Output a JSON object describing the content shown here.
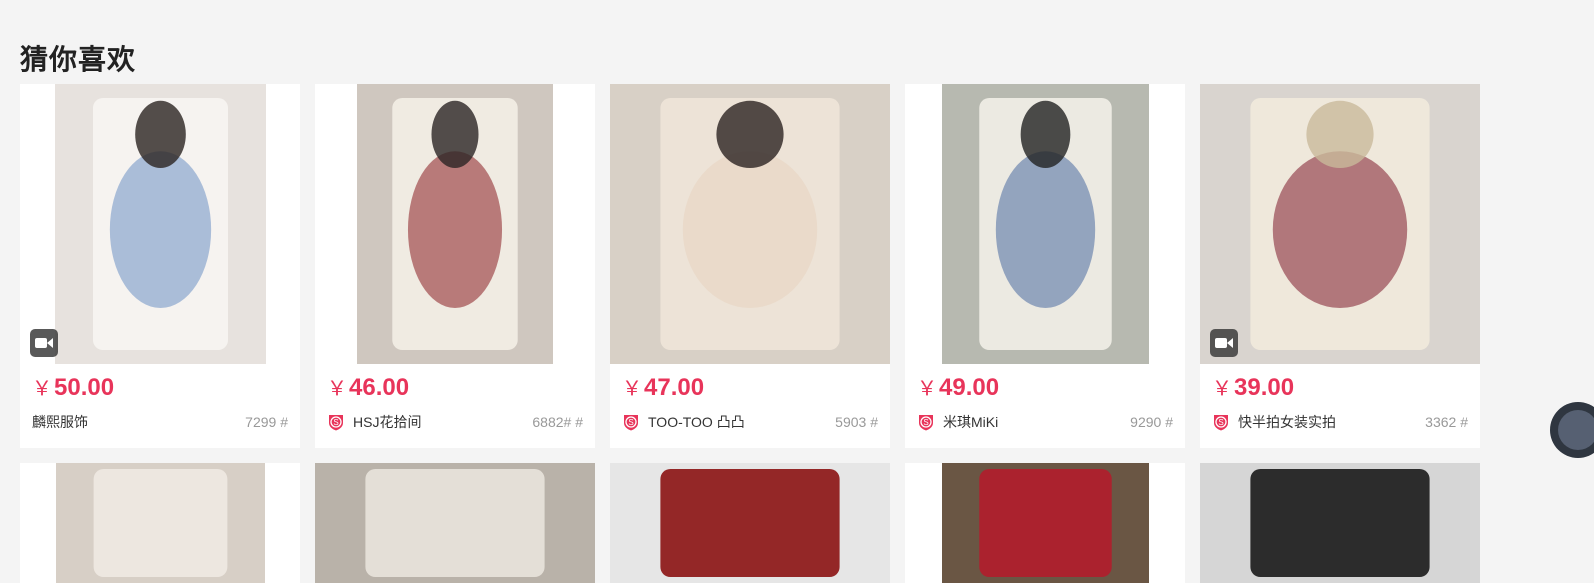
{
  "section_title": "猜你喜欢",
  "row1": [
    {
      "price_symbol": "￥",
      "price": "50.00",
      "shop": "麟熙服饰",
      "shop_badge": false,
      "count": "7299 #",
      "has_video": true,
      "photo_colors": [
        "#e7e2de",
        "#f7f5f2",
        "#6b8fc4",
        "#2b2320"
      ]
    },
    {
      "price_symbol": "￥",
      "price": "46.00",
      "shop": "HSJ花拾间",
      "shop_badge": true,
      "count": "6882# #",
      "has_video": false,
      "photo_colors": [
        "#cfc7bf",
        "#f3eee6",
        "#8b1e22",
        "#2a2424"
      ]
    },
    {
      "price_symbol": "￥",
      "price": "47.00",
      "shop": "TOO-TOO 凸凸",
      "shop_badge": true,
      "count": "5903 #",
      "has_video": false,
      "photo_colors": [
        "#d8d0c6",
        "#efe4d8",
        "#e7d3c0",
        "#2a2220"
      ]
    },
    {
      "price_symbol": "￥",
      "price": "49.00",
      "shop": "米琪MiKi",
      "shop_badge": true,
      "count": "9290 #",
      "has_video": false,
      "photo_colors": [
        "#b7b9b0",
        "#f2efe8",
        "#4b6aa0",
        "#222222"
      ]
    },
    {
      "price_symbol": "￥",
      "price": "39.00",
      "shop": "快半拍女装实拍",
      "shop_badge": true,
      "count": "3362 #",
      "has_video": true,
      "photo_colors": [
        "#d9d4cf",
        "#f1eadc",
        "#7d1a2b",
        "#c9b99b"
      ]
    }
  ],
  "row2": [
    {
      "photo_colors": [
        "#d7cfc6",
        "#efe9e2"
      ]
    },
    {
      "photo_colors": [
        "#b9b2a9",
        "#e9e3db"
      ]
    },
    {
      "photo_colors": [
        "#e6e6e6",
        "#8b1212"
      ]
    },
    {
      "photo_colors": [
        "#6a5644",
        "#b31d2c"
      ]
    },
    {
      "photo_colors": [
        "#d6d6d6",
        "#1a1a1a"
      ]
    }
  ],
  "colors": {
    "accent": "#e8345a",
    "badge": "#e8345a",
    "background": "#f4f4f4"
  },
  "icons": {
    "video": "video-camera-icon",
    "shop_badge": "shop-s-badge-icon"
  }
}
